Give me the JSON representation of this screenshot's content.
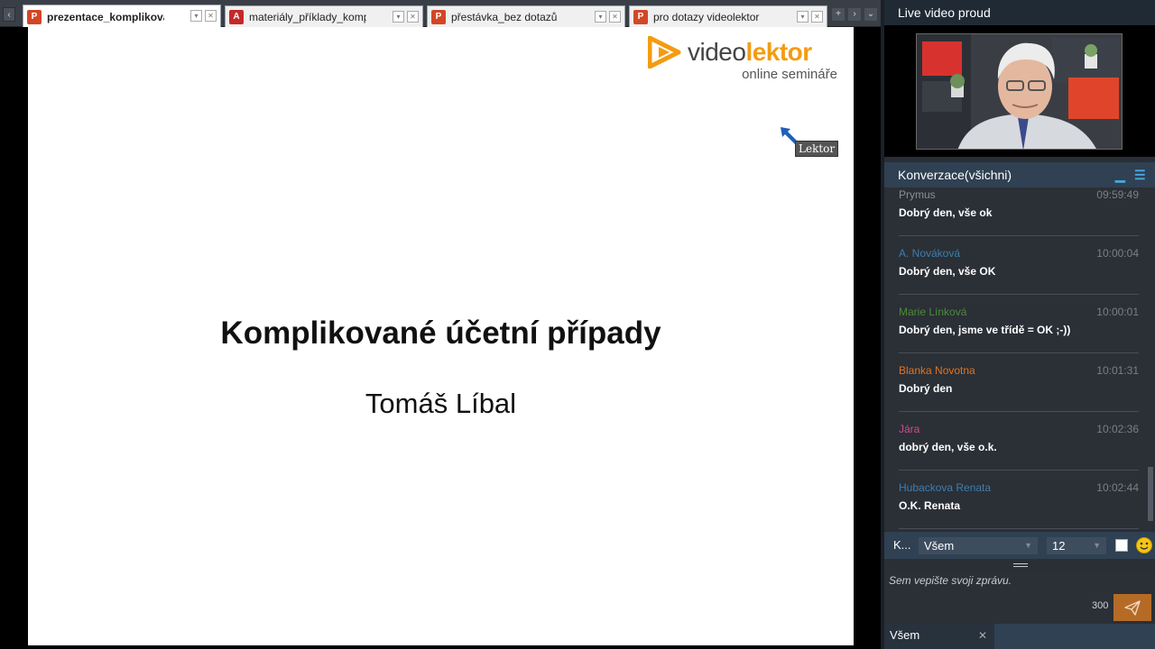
{
  "tabs": [
    {
      "label": "prezentace_komplikova",
      "type": "ppt",
      "active": true
    },
    {
      "label": "materiály_příklady_komp",
      "type": "pdf",
      "active": false
    },
    {
      "label": "přestávka_bez dotazů",
      "type": "ppt",
      "active": false
    },
    {
      "label": "pro dotazy videolektor",
      "type": "ppt",
      "active": false
    }
  ],
  "slide": {
    "brand_part1": "video",
    "brand_part2": "lektor",
    "brand_tagline": "online semináře",
    "pointer_label": "Lektor",
    "title": "Komplikované účetní případy",
    "author": "Tomáš Líbal"
  },
  "video": {
    "header": "Live video proud"
  },
  "conversation": {
    "header": "Konverzace(všichni)",
    "messages": [
      {
        "author": "Prymus",
        "time": "09:59:49",
        "text": "Dobrý den, vše ok",
        "color": "#8a8f97"
      },
      {
        "author": "A. Nováková",
        "time": "10:00:04",
        "text": "Dobrý den, vše OK",
        "color": "#3d7fae"
      },
      {
        "author": "Marie Línková",
        "time": "10:00:01",
        "text": "Dobrý den, jsme ve třídě = OK ;-))",
        "color": "#4d8a3a"
      },
      {
        "author": "Blanka Novotna",
        "time": "10:01:31",
        "text": "Dobrý den",
        "color": "#e0731f"
      },
      {
        "author": "Jára",
        "time": "10:02:36",
        "text": "dobrý den, vše o.k.",
        "color": "#d14a8c"
      },
      {
        "author": "Hubackova Renata",
        "time": "10:02:44",
        "text": "O.K. Renata",
        "color": "#3d7fae"
      }
    ]
  },
  "compose": {
    "label": "K...",
    "recipient": "Všem",
    "font_size": "12",
    "placeholder": "Sem vepište svoji zprávu.",
    "char_count": "300"
  },
  "bottom_tab": {
    "label": "Všem"
  }
}
